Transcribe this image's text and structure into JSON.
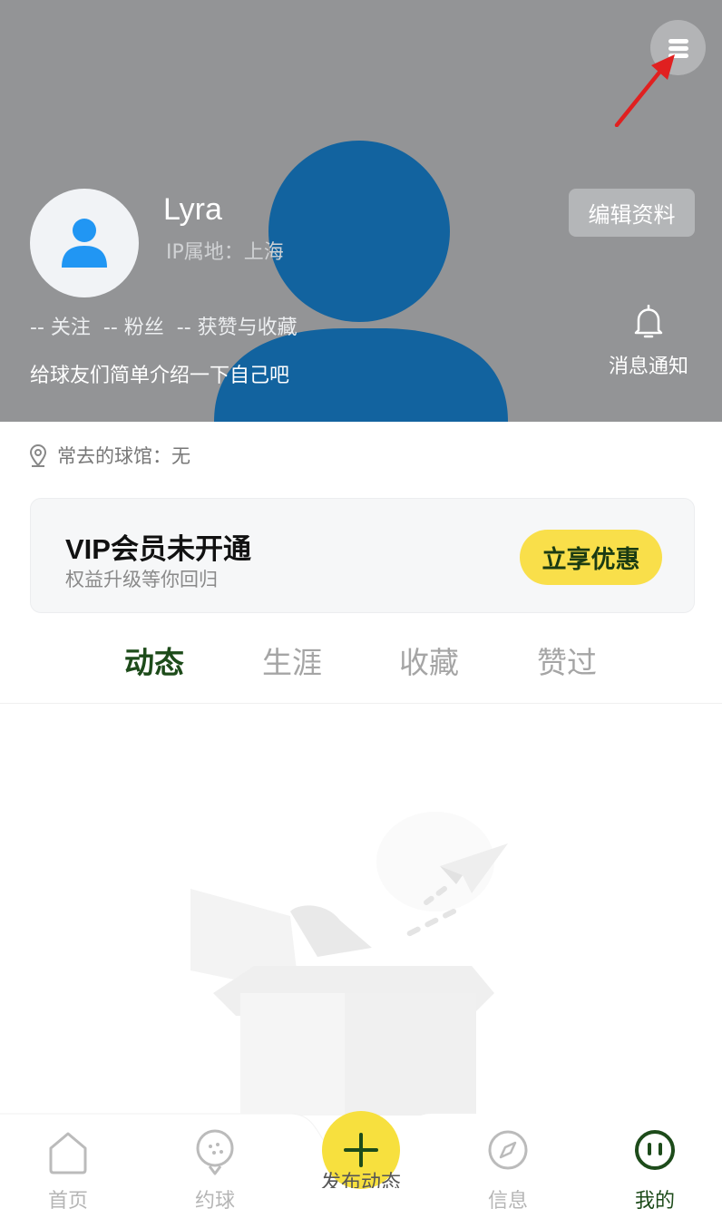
{
  "profile": {
    "username": "Lyra",
    "ip_location": "IP属地：上海",
    "edit_label": "编辑资料",
    "stats": {
      "following": "-- 关注",
      "fans": "-- 粉丝",
      "likes": "-- 获赞与收藏"
    },
    "bio": "给球友们简单介绍一下自己吧",
    "notify_label": "消息通知"
  },
  "venue": {
    "text": "常去的球馆：无"
  },
  "vip": {
    "title": "VIP会员未开通",
    "subtitle": "权益升级等你回归",
    "button": "立享优惠"
  },
  "tabs": [
    {
      "label": "动态",
      "active": true
    },
    {
      "label": "生涯",
      "active": false
    },
    {
      "label": "收藏",
      "active": false
    },
    {
      "label": "赞过",
      "active": false
    }
  ],
  "bottom_nav": {
    "items": [
      {
        "label": "首页",
        "icon": "home-icon"
      },
      {
        "label": "约球",
        "icon": "golf-ball-icon"
      },
      {
        "label": "信息",
        "icon": "compass-icon"
      },
      {
        "label": "我的",
        "icon": "smile-face-icon",
        "active": true
      }
    ],
    "fab_label": "发布动态"
  },
  "colors": {
    "header_bg": "#939496",
    "accent_green": "#1d4b1a",
    "accent_yellow": "#f9df4a",
    "annotation_red": "#e02020",
    "avatar_blue": "#2196f3"
  },
  "icons": [
    "menu-icon",
    "annotation-arrow-icon",
    "user-icon",
    "bell-icon",
    "location-pin-icon",
    "plus-icon"
  ]
}
